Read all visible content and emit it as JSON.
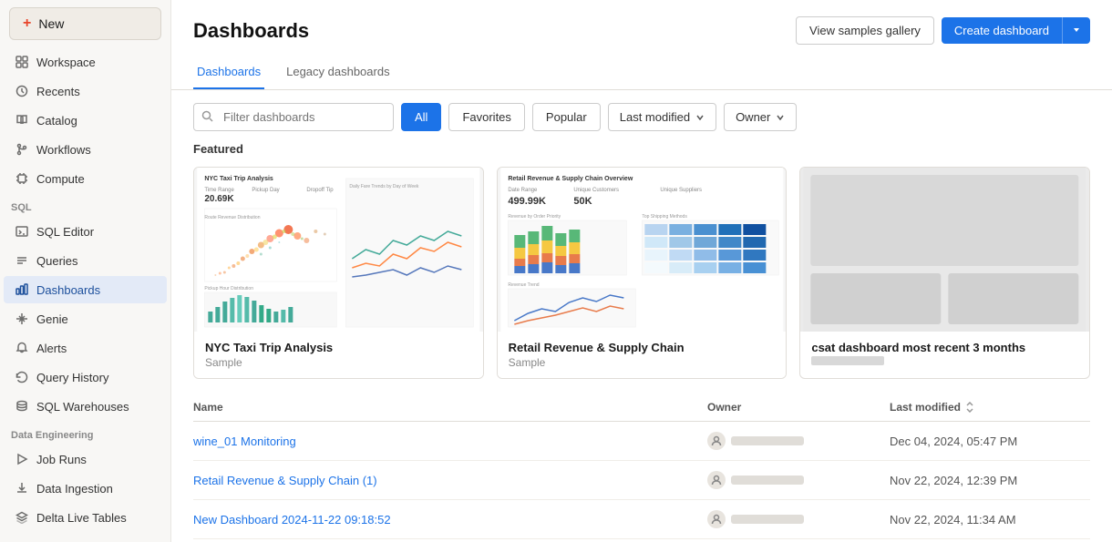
{
  "sidebar": {
    "new_label": "New",
    "items": [
      {
        "id": "workspace",
        "label": "Workspace",
        "icon": "grid"
      },
      {
        "id": "recents",
        "label": "Recents",
        "icon": "clock"
      },
      {
        "id": "catalog",
        "label": "Catalog",
        "icon": "book"
      },
      {
        "id": "workflows",
        "label": "Workflows",
        "icon": "git-branch"
      },
      {
        "id": "compute",
        "label": "Compute",
        "icon": "cpu"
      }
    ],
    "sql_section": "SQL",
    "sql_items": [
      {
        "id": "sql-editor",
        "label": "SQL Editor",
        "icon": "terminal"
      },
      {
        "id": "queries",
        "label": "Queries",
        "icon": "list"
      },
      {
        "id": "dashboards",
        "label": "Dashboards",
        "icon": "bar-chart",
        "active": true
      },
      {
        "id": "genie",
        "label": "Genie",
        "icon": "sparkle"
      },
      {
        "id": "alerts",
        "label": "Alerts",
        "icon": "bell"
      },
      {
        "id": "query-history",
        "label": "Query History",
        "icon": "history"
      },
      {
        "id": "sql-warehouses",
        "label": "SQL Warehouses",
        "icon": "database"
      }
    ],
    "data_eng_section": "Data Engineering",
    "data_eng_items": [
      {
        "id": "job-runs",
        "label": "Job Runs",
        "icon": "play"
      },
      {
        "id": "data-ingestion",
        "label": "Data Ingestion",
        "icon": "download"
      },
      {
        "id": "delta-live",
        "label": "Delta Live Tables",
        "icon": "layers"
      }
    ]
  },
  "header": {
    "title": "Dashboards",
    "view_samples_label": "View samples gallery",
    "create_dashboard_label": "Create dashboard"
  },
  "tabs": [
    {
      "id": "dashboards",
      "label": "Dashboards",
      "active": true
    },
    {
      "id": "legacy",
      "label": "Legacy dashboards",
      "active": false
    }
  ],
  "filter_bar": {
    "search_placeholder": "Filter dashboards",
    "buttons": [
      {
        "id": "all",
        "label": "All",
        "active": true
      },
      {
        "id": "favorites",
        "label": "Favorites",
        "active": false
      },
      {
        "id": "popular",
        "label": "Popular",
        "active": false
      }
    ],
    "last_modified_label": "Last modified",
    "owner_label": "Owner"
  },
  "featured": {
    "section_label": "Featured",
    "cards": [
      {
        "id": "nyc-taxi",
        "title": "NYC Taxi Trip Analysis",
        "subtitle": "Sample"
      },
      {
        "id": "retail-revenue",
        "title": "Retail Revenue & Supply Chain",
        "subtitle": "Sample"
      },
      {
        "id": "csat",
        "title": "csat dashboard most recent 3 months",
        "subtitle": ""
      }
    ]
  },
  "table": {
    "col_name": "Name",
    "col_owner": "Owner",
    "col_modified": "Last modified",
    "rows": [
      {
        "name": "wine_01 Monitoring",
        "modified": "Dec 04, 2024, 05:47 PM"
      },
      {
        "name": "Retail Revenue & Supply Chain (1)",
        "modified": "Nov 22, 2024, 12:39 PM"
      },
      {
        "name": "New Dashboard 2024-11-22 09:18:52",
        "modified": "Nov 22, 2024, 11:34 AM"
      }
    ]
  }
}
